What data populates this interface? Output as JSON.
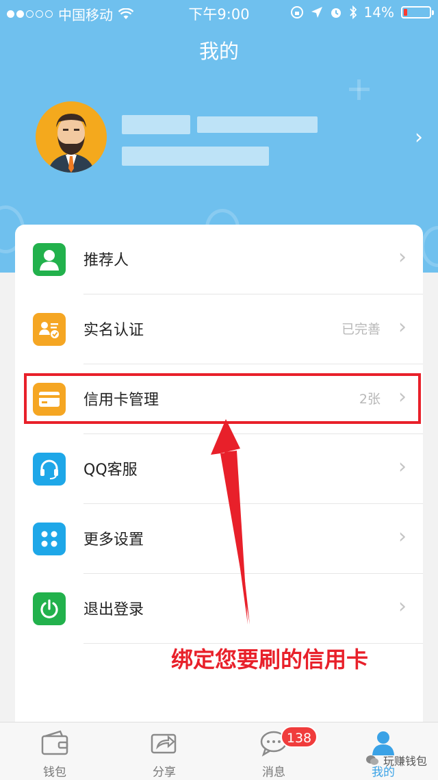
{
  "status_bar": {
    "carrier": "中国移动",
    "time": "下午9:00",
    "battery": "14%",
    "battery_level": 0.14
  },
  "page": {
    "title": "我的"
  },
  "menu": [
    {
      "label": "推荐人",
      "value": "",
      "icon": "person-icon",
      "color": "#22b14c"
    },
    {
      "label": "实名认证",
      "value": "已完善",
      "icon": "id-card-check-icon",
      "color": "#f5a623"
    },
    {
      "label": "信用卡管理",
      "value": "2张",
      "icon": "credit-card-icon",
      "color": "#f5a623"
    },
    {
      "label": "QQ客服",
      "value": "",
      "icon": "headset-icon",
      "color": "#1ea7e8"
    },
    {
      "label": "更多设置",
      "value": "",
      "icon": "grid-icon",
      "color": "#1ea7e8"
    },
    {
      "label": "退出登录",
      "value": "",
      "icon": "power-icon",
      "color": "#22b14c"
    }
  ],
  "annotation": {
    "text": "绑定您要刷的信用卡",
    "color": "#e8202a"
  },
  "tabs": [
    {
      "label": "钱包",
      "icon": "wallet-icon"
    },
    {
      "label": "分享",
      "icon": "share-icon"
    },
    {
      "label": "消息",
      "icon": "message-icon",
      "badge": "138"
    },
    {
      "label": "我的",
      "icon": "profile-icon",
      "active": true
    }
  ],
  "watermark": {
    "text": "玩赚钱包"
  },
  "colors": {
    "header": "#6fc0ee",
    "accent": "#3aa2e6",
    "badge": "#f03c3c"
  }
}
